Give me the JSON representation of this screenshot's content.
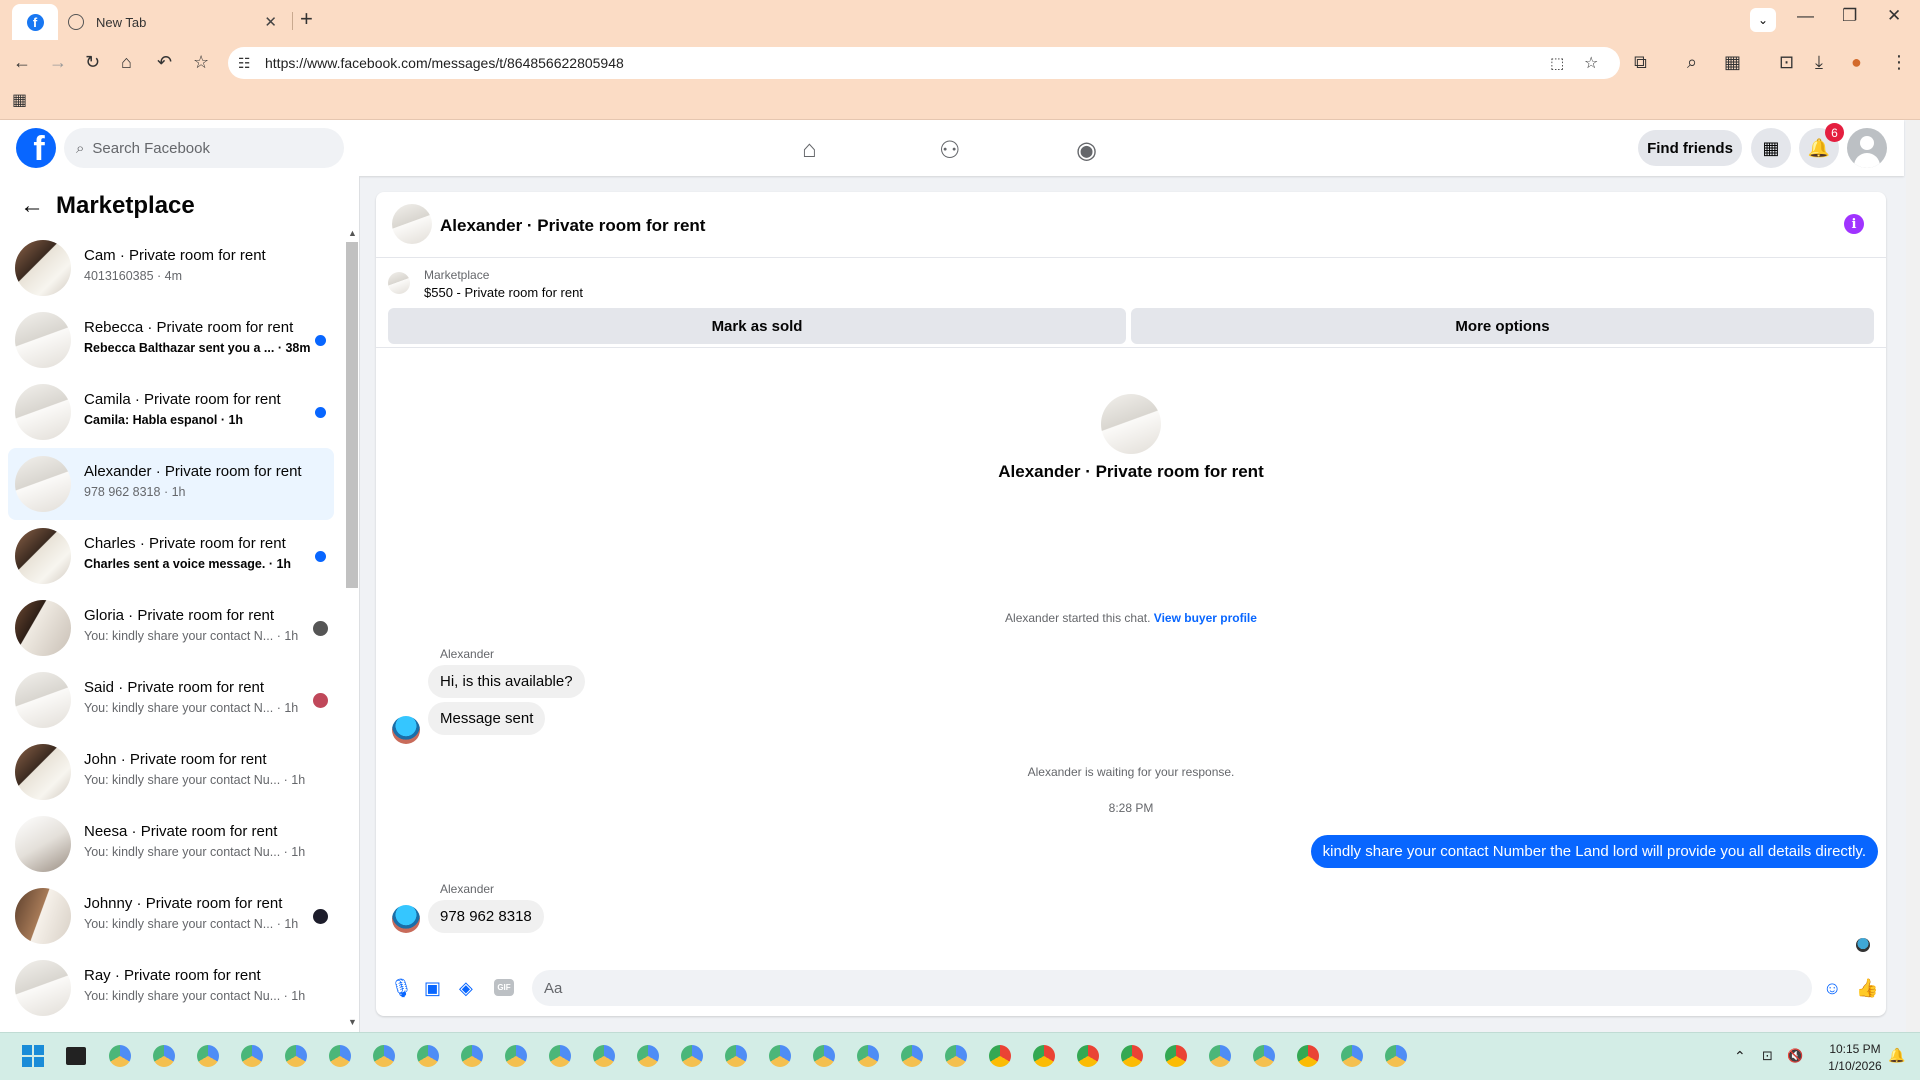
{
  "browser": {
    "tab_title": "New Tab",
    "url": "https://www.facebook.com/messages/t/864856622805948"
  },
  "header": {
    "search_placeholder": "Search Facebook",
    "find_friends": "Find friends",
    "notification_count": "6"
  },
  "sidebar": {
    "title": "Marketplace",
    "conversations": [
      {
        "name": "Cam · Private room for rent",
        "sub": "4013160385 · 4m",
        "unread": false,
        "indicator": "none"
      },
      {
        "name": "Rebecca · Private room for rent",
        "sub": "Rebecca Balthazar sent you a ... · 38m",
        "unread": true,
        "indicator": "dot"
      },
      {
        "name": "Camila · Private room for rent",
        "sub": "Camila: Habla espanol · 1h",
        "unread": true,
        "indicator": "dot"
      },
      {
        "name": "Alexander · Private room for rent",
        "sub": "978 962 8318 · 1h",
        "unread": false,
        "indicator": "none",
        "active": true
      },
      {
        "name": "Charles · Private room for rent",
        "sub": "Charles sent a voice message. · 1h",
        "unread": true,
        "indicator": "dot"
      },
      {
        "name": "Gloria · Private room for rent",
        "sub": "You: kindly share your contact N... · 1h",
        "unread": false,
        "indicator": "avatar"
      },
      {
        "name": "Said · Private room for rent",
        "sub": "You: kindly share your contact N... · 1h",
        "unread": false,
        "indicator": "avatar"
      },
      {
        "name": "John · Private room for rent",
        "sub": "You: kindly share your contact Nu... · 1h",
        "unread": false,
        "indicator": "none"
      },
      {
        "name": "Neesa · Private room for rent",
        "sub": "You: kindly share your contact Nu... · 1h",
        "unread": false,
        "indicator": "none"
      },
      {
        "name": "Johnny · Private room for rent",
        "sub": "You: kindly share your contact N... · 1h",
        "unread": false,
        "indicator": "avatar"
      },
      {
        "name": "Ray · Private room for rent",
        "sub": "You: kindly share your contact Nu... · 1h",
        "unread": false,
        "indicator": "none"
      }
    ]
  },
  "chat": {
    "title": "Alexander · Private room for rent",
    "marketplace_label": "Marketplace",
    "listing": "$550 - Private room for rent",
    "mark_sold": "Mark as sold",
    "more_options": "More options",
    "hero_title": "Alexander · Private room for rent",
    "started_note": "Alexander started this chat.",
    "view_profile": "View buyer profile",
    "sender1": "Alexander",
    "msg1": "Hi, is this available?",
    "msg2": "Message sent",
    "waiting_note": "Alexander is waiting for your response.",
    "time": "8:28 PM",
    "msg_out": "kindly share your contact Number the Land lord will provide you all details directly.",
    "sender2": "Alexander",
    "msg3": "978 962 8318",
    "composer_placeholder": "Aa"
  },
  "taskbar": {
    "time": "10:15 PM",
    "date": "1/10/2026"
  }
}
